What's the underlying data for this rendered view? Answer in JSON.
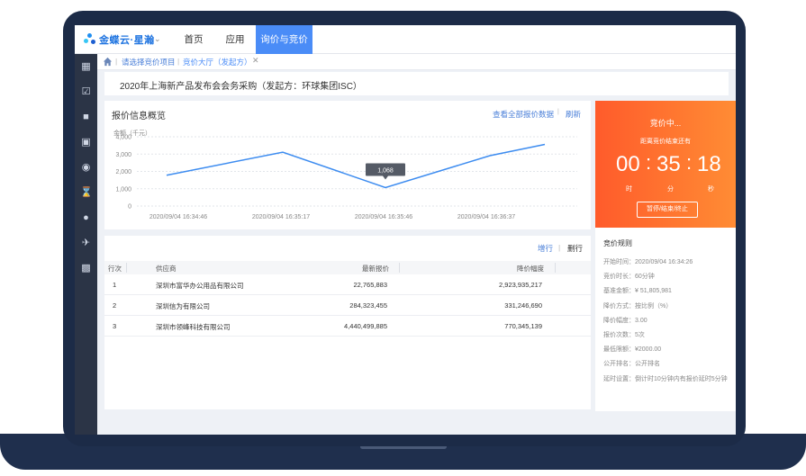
{
  "brand": "金蝶云·星瀚",
  "nav": [
    "首页",
    "应用",
    "询价与竞价"
  ],
  "tabs": {
    "first": "请选择竞价项目",
    "second": "竞价大厅（发起方）"
  },
  "page_title": "2020年上海新产品发布会会务采购（发起方：环球集团ISC）",
  "chart_panel": {
    "title": "报价信息概览",
    "link_all": "查看全部报价数据",
    "link_refresh": "刷新",
    "separator": "|"
  },
  "chart_data": {
    "type": "line",
    "ylabel": "金额（千元）",
    "yticks": [
      "4,000",
      "3,000",
      "2,000",
      "1,000",
      "0"
    ],
    "ylim": [
      0,
      4000
    ],
    "xticks": [
      "2020/09/04 16:34:46",
      "2020/09/04 16:35:17",
      "2020/09/04 16:35:46",
      "2020/09/04 16:36:37"
    ],
    "points": [
      1780,
      3110,
      1068,
      2910,
      3560
    ],
    "tooltip": "1,068",
    "grid": true
  },
  "table": {
    "add_row": "增行",
    "del_row": "删行",
    "headers": [
      "行次",
      "供应商",
      "最新报价",
      "降价幅度"
    ],
    "rows": [
      [
        "1",
        "深圳市富华办公用品有限公司",
        "22,765,883",
        "2,923,935,217"
      ],
      [
        "2",
        "深圳信为有限公司",
        "284,323,455",
        "331,246,690"
      ],
      [
        "3",
        "深圳市领峰科技有限公司",
        "4,440,499,885",
        "770,345,139"
      ]
    ]
  },
  "auction": {
    "status": "竞价中...",
    "countdown_label": "距离竞价结束还有",
    "hours": "00",
    "minutes": "35",
    "seconds": "18",
    "unit_h": "时",
    "unit_m": "分",
    "unit_s": "秒",
    "button": "暂停/结束/终止",
    "colon": ":"
  },
  "rules": {
    "title": "竞价规则",
    "items": [
      "开始时间：2020/09/04 16:34:26",
      "竞价时长：60分钟",
      "基准金额：¥ 51,805,981",
      "降价方式：按比例（%）",
      "降价幅度：3.00",
      "报价次数：5次",
      "最低限额：¥2000.00",
      "公开排名：公开排名",
      "延时设置：倒计时10分钟内有报价延时5分钟"
    ]
  },
  "colors": {
    "accent": "#4a8cf7",
    "auction": "#ff6a30",
    "sidebar": "#2b3446",
    "frame": "#1c2b47"
  }
}
